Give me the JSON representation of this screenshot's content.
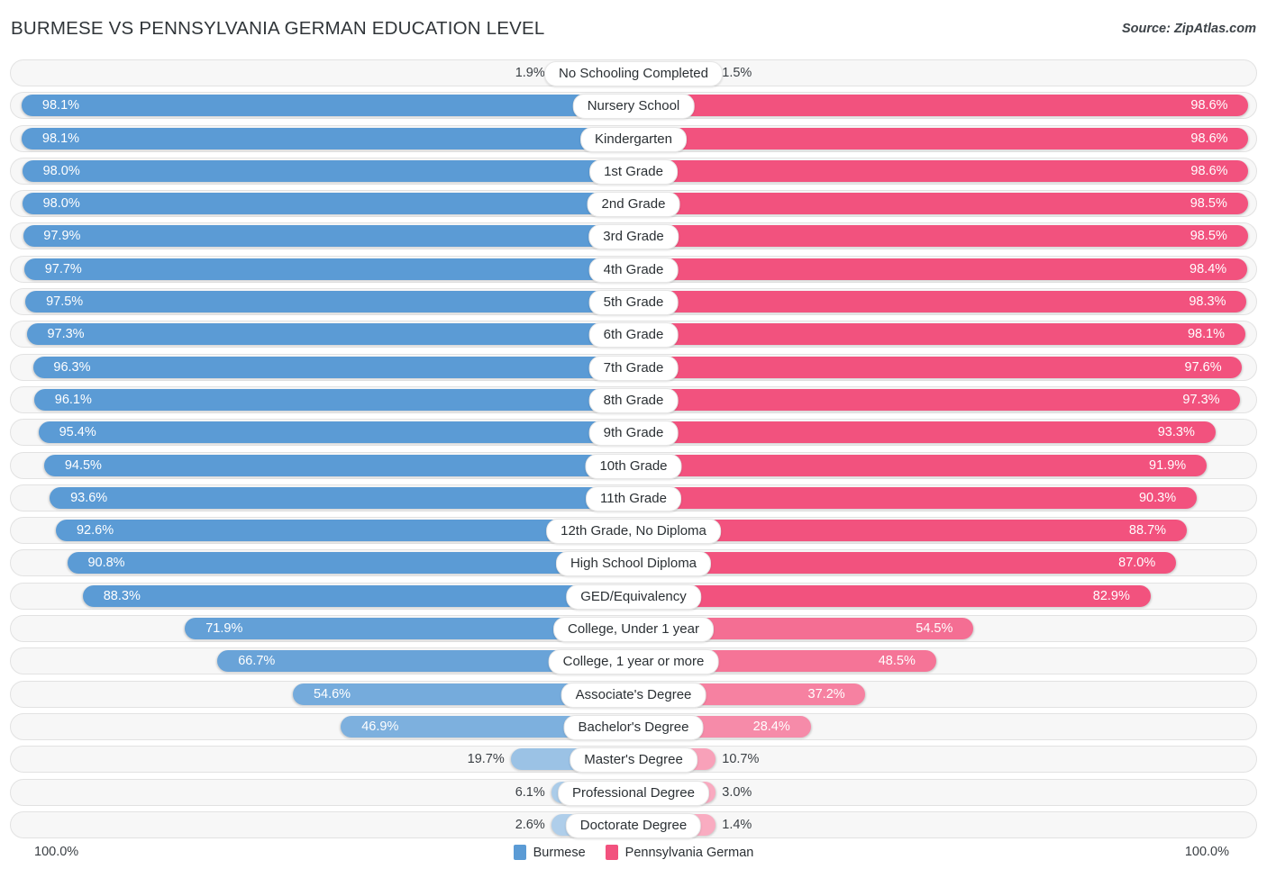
{
  "header": {
    "title": "BURMESE VS PENNSYLVANIA GERMAN EDUCATION LEVEL",
    "source": "Source: ZipAtlas.com"
  },
  "legend": {
    "items": [
      {
        "label": "Burmese",
        "color": "#5b9bd5"
      },
      {
        "label": "Pennsylvania German",
        "color": "#f2527e"
      }
    ]
  },
  "axis": {
    "left_max": "100.0%",
    "right_max": "100.0%"
  },
  "chart_data": {
    "type": "bar",
    "subtype": "diverging-bidirectional",
    "title": "BURMESE VS PENNSYLVANIA GERMAN EDUCATION LEVEL",
    "xlabel": "",
    "ylabel": "",
    "xlim": [
      0,
      100
    ],
    "grid": false,
    "legend_position": "bottom-center",
    "categories": [
      "No Schooling Completed",
      "Nursery School",
      "Kindergarten",
      "1st Grade",
      "2nd Grade",
      "3rd Grade",
      "4th Grade",
      "5th Grade",
      "6th Grade",
      "7th Grade",
      "8th Grade",
      "9th Grade",
      "10th Grade",
      "11th Grade",
      "12th Grade, No Diploma",
      "High School Diploma",
      "GED/Equivalency",
      "College, Under 1 year",
      "College, 1 year or more",
      "Associate's Degree",
      "Bachelor's Degree",
      "Master's Degree",
      "Professional Degree",
      "Doctorate Degree"
    ],
    "series": [
      {
        "name": "Burmese",
        "color": "#5b9bd5",
        "values": [
          1.9,
          98.1,
          98.1,
          98.0,
          98.0,
          97.9,
          97.7,
          97.5,
          97.3,
          96.3,
          96.1,
          95.4,
          94.5,
          93.6,
          92.6,
          90.8,
          88.3,
          71.9,
          66.7,
          54.6,
          46.9,
          19.7,
          6.1,
          2.6
        ],
        "labels": [
          "1.9%",
          "98.1%",
          "98.1%",
          "98.0%",
          "98.0%",
          "97.9%",
          "97.7%",
          "97.5%",
          "97.3%",
          "96.3%",
          "96.1%",
          "95.4%",
          "94.5%",
          "93.6%",
          "92.6%",
          "90.8%",
          "88.3%",
          "71.9%",
          "66.7%",
          "54.6%",
          "46.9%",
          "19.7%",
          "6.1%",
          "2.6%"
        ]
      },
      {
        "name": "Pennsylvania German",
        "color": "#f2527e",
        "values": [
          1.5,
          98.6,
          98.6,
          98.6,
          98.5,
          98.5,
          98.4,
          98.3,
          98.1,
          97.6,
          97.3,
          93.3,
          91.9,
          90.3,
          88.7,
          87.0,
          82.9,
          54.5,
          48.5,
          37.2,
          28.4,
          10.7,
          3.0,
          1.4
        ],
        "labels": [
          "1.5%",
          "98.6%",
          "98.6%",
          "98.6%",
          "98.5%",
          "98.5%",
          "98.4%",
          "98.3%",
          "98.1%",
          "97.6%",
          "97.3%",
          "93.3%",
          "91.9%",
          "90.3%",
          "88.7%",
          "87.0%",
          "82.9%",
          "54.5%",
          "48.5%",
          "37.2%",
          "28.4%",
          "10.7%",
          "3.0%",
          "1.4%"
        ]
      }
    ]
  }
}
